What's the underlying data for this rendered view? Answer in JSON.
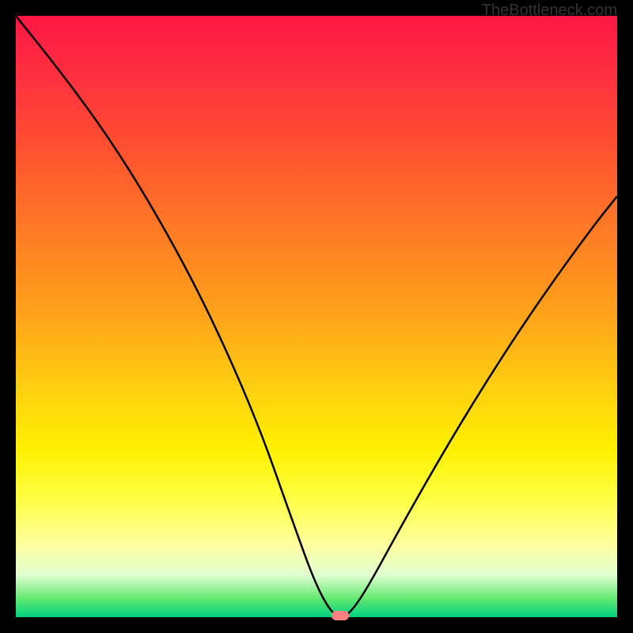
{
  "watermark": "TheBottleneck.com",
  "chart_data": {
    "type": "line",
    "title": "",
    "xlabel": "",
    "ylabel": "",
    "ylim": [
      0,
      100
    ],
    "xlim": [
      0,
      100
    ],
    "series": [
      {
        "name": "bottleneck-curve",
        "x": [
          0,
          8,
          16,
          24,
          32,
          40,
          46,
          50,
          53,
          55,
          58,
          64,
          72,
          80,
          88,
          96,
          100
        ],
        "values": [
          100,
          90,
          79,
          66,
          51,
          33,
          16,
          5,
          0,
          0,
          4,
          15,
          29,
          42,
          54,
          65,
          70
        ]
      }
    ],
    "marker": {
      "x": 54,
      "y": 0,
      "color": "#ff8080"
    },
    "gradient_stops": [
      {
        "pct": 0,
        "color": "#ff1744"
      },
      {
        "pct": 50,
        "color": "#ffaa18"
      },
      {
        "pct": 75,
        "color": "#fff000"
      },
      {
        "pct": 100,
        "color": "#00d080"
      }
    ]
  }
}
